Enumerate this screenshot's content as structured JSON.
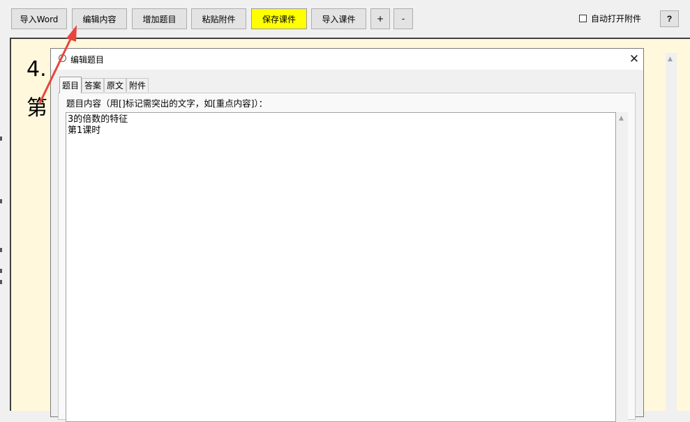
{
  "toolbar": {
    "import_word": "导入Word",
    "edit_content": "编辑内容",
    "add_question": "增加题目",
    "paste_attachment": "粘贴附件",
    "save_courseware": "保存课件",
    "import_courseware": "导入课件",
    "plus": "+",
    "minus": "-",
    "auto_open_label": "自动打开附件",
    "help": "?"
  },
  "slide": {
    "line1": "4.",
    "line2": "第"
  },
  "dialog": {
    "title": "编辑题目",
    "close": "✕",
    "tabs": [
      {
        "label": "题目"
      },
      {
        "label": "答案"
      },
      {
        "label": "原文"
      },
      {
        "label": "附件"
      }
    ],
    "content_label": "题目内容（用[]标记需突出的文字，如[重点内容]）：",
    "editor_value": "3的倍数的特征\n第1课时"
  },
  "icons": {
    "scroll_up": "▲",
    "arrow_color": "#e8453c"
  }
}
